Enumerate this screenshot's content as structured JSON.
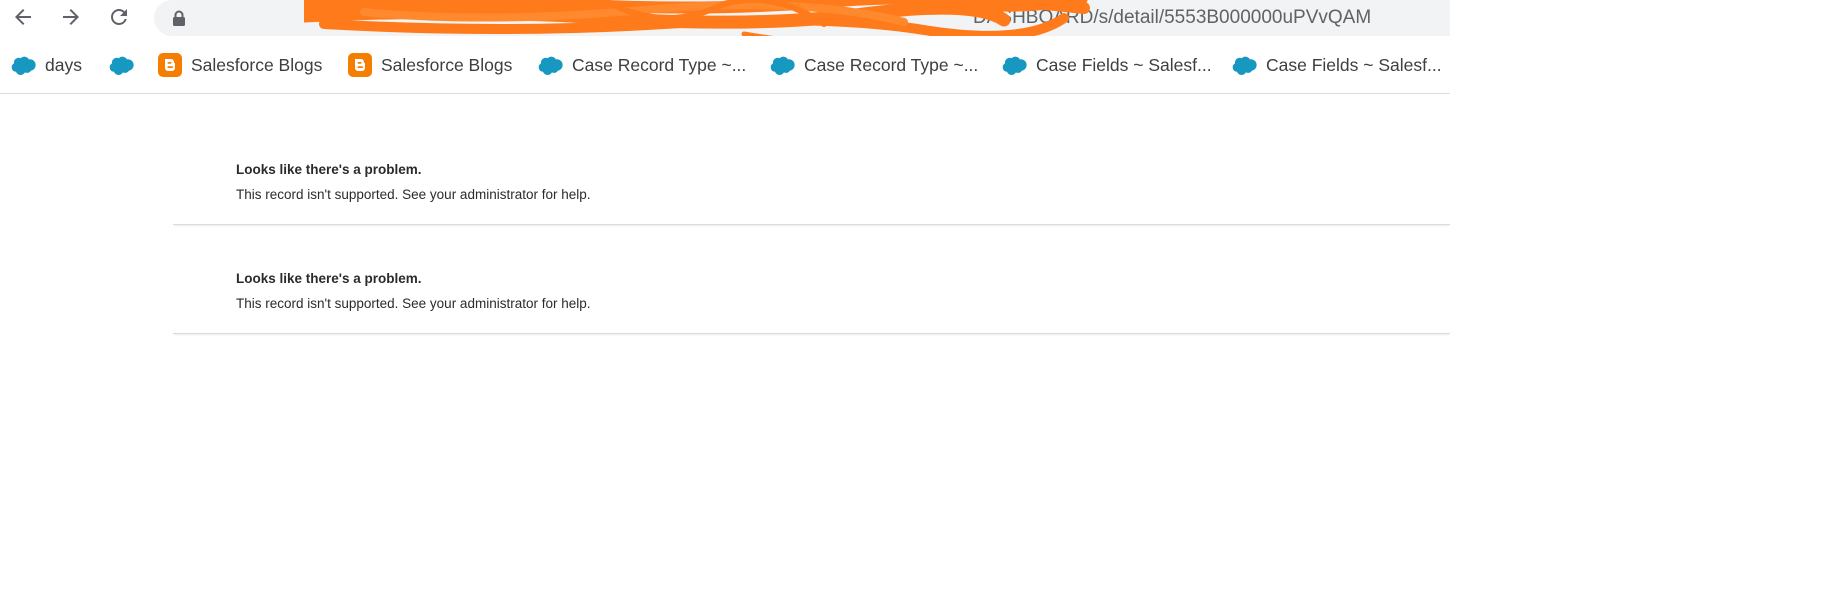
{
  "browser": {
    "url_visible_tail": "DASHBOARD/s/detail/5553B000000uPVvQAM",
    "url_redacted": true,
    "redaction_color": "#ff7a1a"
  },
  "bookmarks": [
    {
      "icon": "salesforce-cloud-icon",
      "label": "days"
    },
    {
      "icon": "salesforce-cloud-icon",
      "label": ""
    },
    {
      "icon": "blogger-icon",
      "label": "Salesforce Blogs"
    },
    {
      "icon": "blogger-icon",
      "label": "Salesforce Blogs"
    },
    {
      "icon": "salesforce-cloud-icon",
      "label": "Case Record Type ~..."
    },
    {
      "icon": "salesforce-cloud-icon",
      "label": "Case Record Type ~..."
    },
    {
      "icon": "salesforce-cloud-icon",
      "label": "Case Fields ~ Salesf..."
    },
    {
      "icon": "salesforce-cloud-icon",
      "label": "Case Fields ~ Salesf..."
    }
  ],
  "errors": [
    {
      "title": "Looks like there's a problem.",
      "message": "This record isn't supported. See your administrator for help."
    },
    {
      "title": "Looks like there's a problem.",
      "message": "This record isn't supported. See your administrator for help."
    }
  ],
  "colors": {
    "salesforce_blue": "#1798c1",
    "blogger_orange": "#f57d00",
    "toolbar_icon": "#5f6368"
  }
}
